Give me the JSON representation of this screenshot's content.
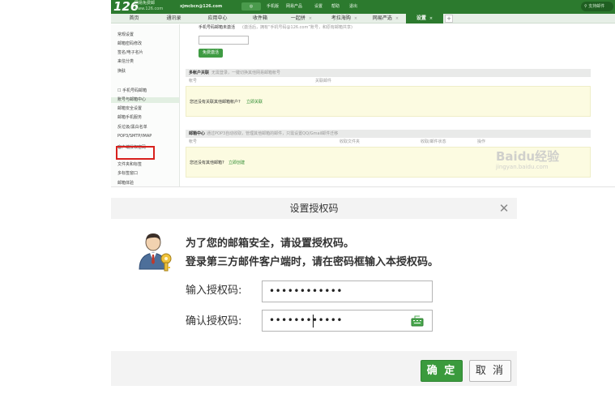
{
  "mail": {
    "logo": "126",
    "logo_sub": "网易免费邮",
    "logo_url": "www.126.com",
    "account": "xjmcbcn@126.com",
    "topbar_items": [
      "手机版",
      "网易产品",
      "设置",
      "帮助",
      "退出"
    ],
    "search_placeholder": "支持邮件",
    "tabs": [
      {
        "label": "首页"
      },
      {
        "label": "通讯录"
      },
      {
        "label": "应用中心"
      },
      {
        "label": "收件箱"
      },
      {
        "label": "一起拼"
      },
      {
        "label": "考拉海购"
      },
      {
        "label": "网易严选"
      },
      {
        "label": "设置",
        "active": true
      }
    ],
    "sidebar_items": [
      "常规设置",
      "邮箱密码修改",
      "签名/电子名片",
      "来信分类",
      "换肤",
      "☐ 手机号码邮箱",
      "账号与邮箱中心",
      "邮箱安全设置",
      "邮箱手机服务",
      "反垃圾/黑白名单",
      "POP3/SMTP/IMAP",
      "客户端授权密码",
      "文件夹和标签",
      "多标签窗口",
      "邮箱体验"
    ],
    "content": {
      "phone_activate": "手机号码邮箱未激活",
      "phone_hint": "(激活后，拥有“手机号码@126.com”账号，和原有邮箱共享)",
      "activate_button": "免费激活",
      "multi_account_title": "多帐户关联",
      "multi_account_desc": "无需登录，一键切换其他网易邮箱帐号",
      "col_account": "帐号",
      "col_type": "关联邮件",
      "no_linked": "您还没有关联其他邮箱帐户?",
      "link_now": "立即关联",
      "mail_center_title": "邮箱中心",
      "mail_center_desc": "通过POP3自动收取，管理其他邮箱的邮件，只需设置QQ/Gmail邮件迁移",
      "col_folder": "收取文件夹",
      "col_status": "收取/邮件状态",
      "col_action": "操作",
      "no_other": "您还没有其他邮箱?",
      "create_now": "立即创建",
      "watermark": "Baidu经验",
      "watermark_url": "jingyan.baidu.com"
    }
  },
  "dialog": {
    "title": "设置授权码",
    "message_line1": "为了您的邮箱安全，请设置授权码。",
    "message_line2": "登录第三方邮件客户端时，请在密码框输入本授权码。",
    "input_label": "输入授权码:",
    "input_value": "••••••••••••",
    "confirm_label": "确认授权码:",
    "confirm_value": "••••••••••••",
    "ok_button": "确 定",
    "cancel_button": "取 消",
    "close_symbol": "✕"
  },
  "colors": {
    "brand_green": "#2c7a2e",
    "button_green": "#3a9a3d",
    "highlight_red": "#d8211d"
  }
}
